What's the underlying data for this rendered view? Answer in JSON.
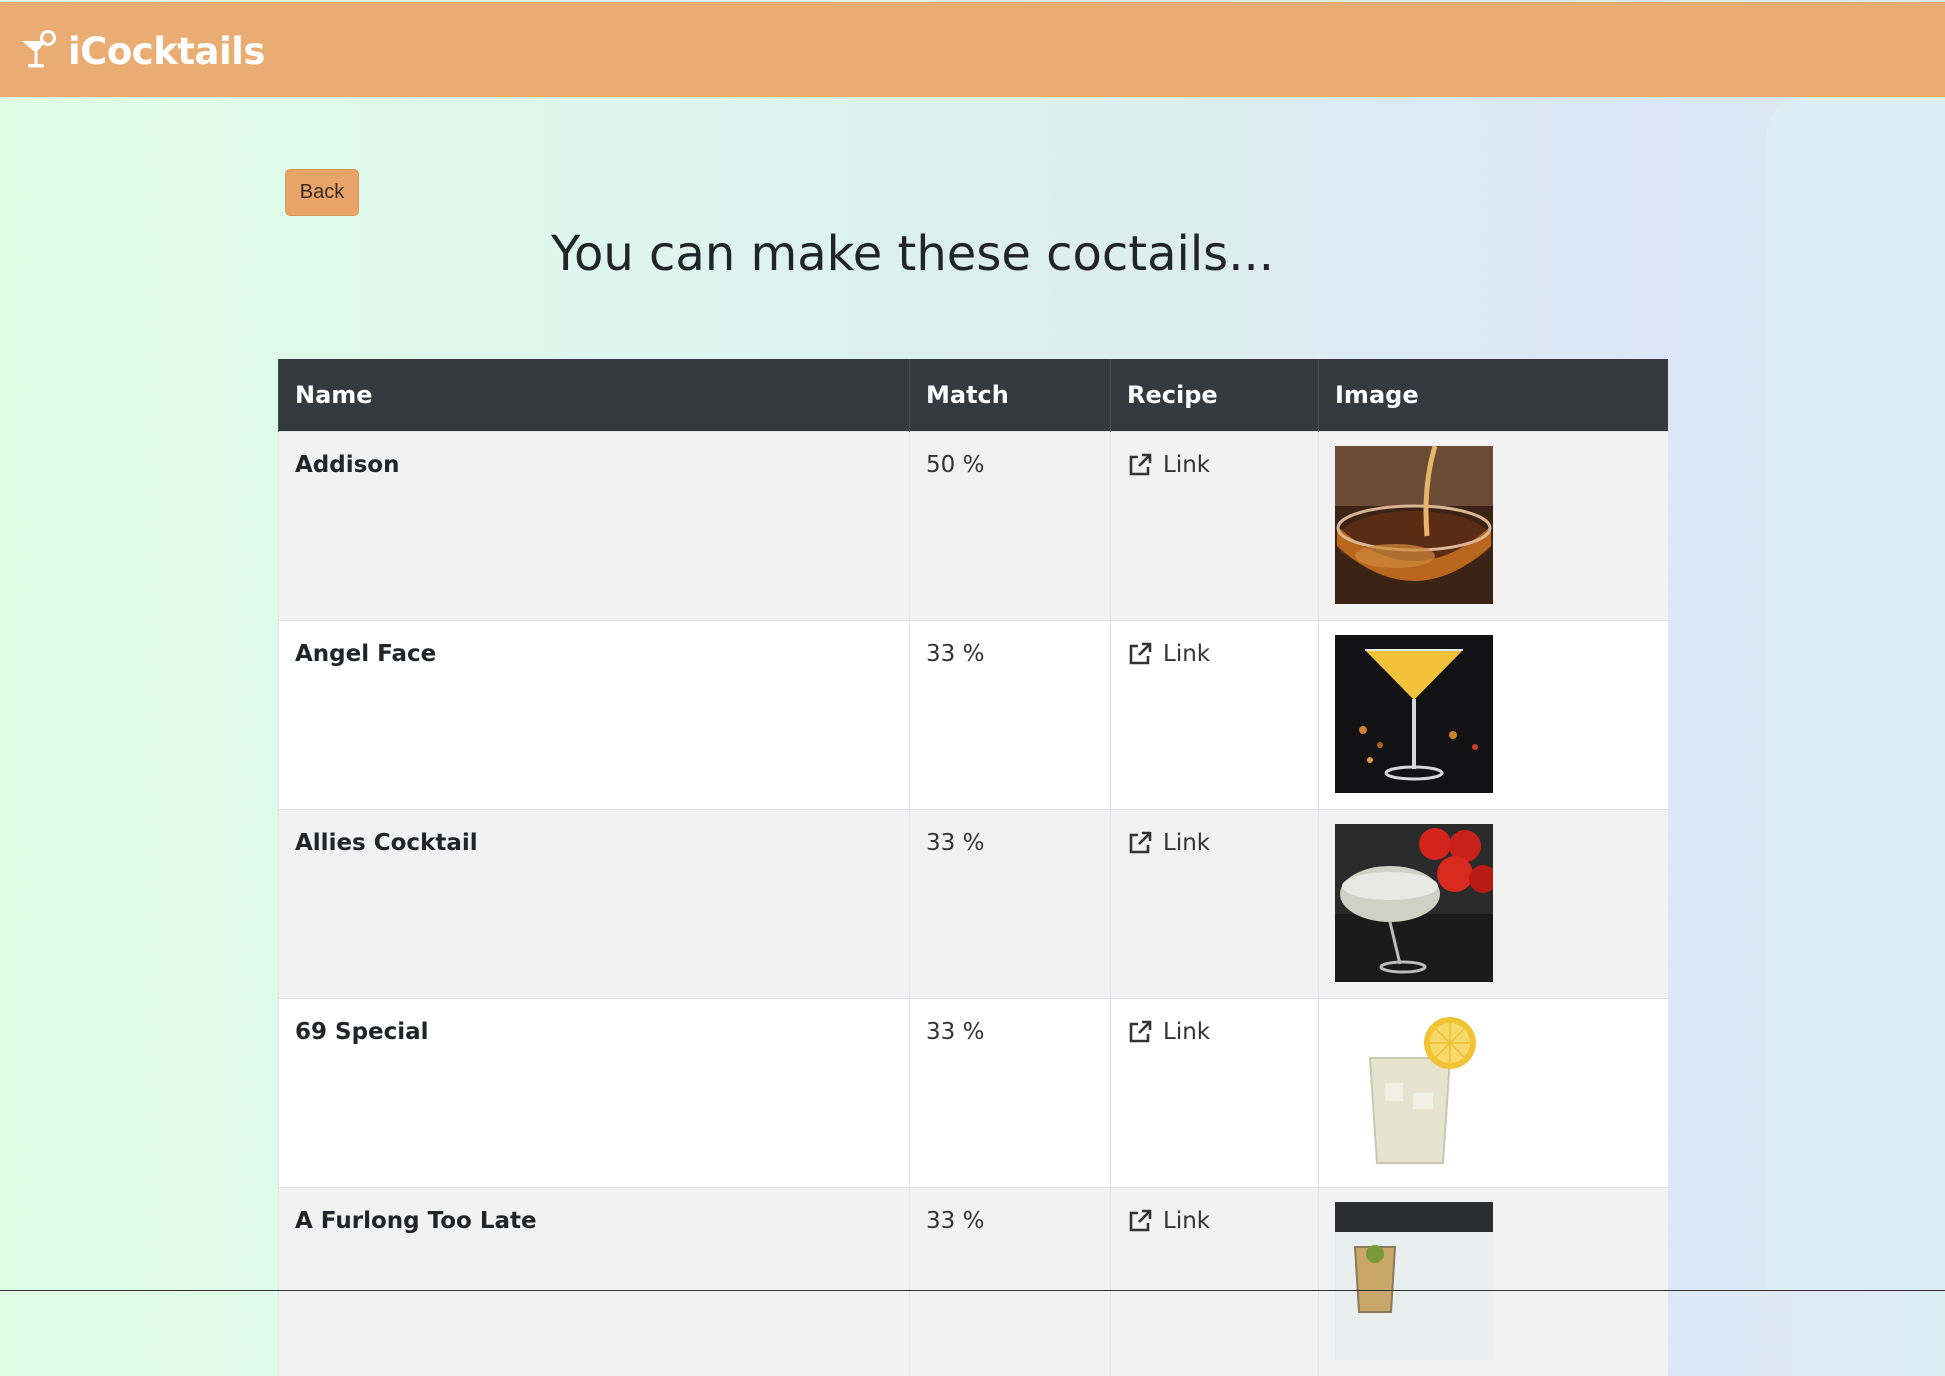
{
  "navbar": {
    "brand": "iCocktails",
    "brand_icon": "cocktail-glass-icon",
    "color": "#e9ac72"
  },
  "back_label": "Back",
  "page_title": "You can make these coctails...",
  "table": {
    "headers": [
      "Name",
      "Match",
      "Recipe",
      "Image"
    ],
    "rows": [
      {
        "name": "Addison",
        "match": "50 %",
        "recipe": "Link",
        "image": "amber-pour-image"
      },
      {
        "name": "Angel Face",
        "match": "33 %",
        "recipe": "Link",
        "image": "yellow-martini-image"
      },
      {
        "name": "Allies Cocktail",
        "match": "33 %",
        "recipe": "Link",
        "image": "coupe-tomatoes-image"
      },
      {
        "name": "69 Special",
        "match": "33 %",
        "recipe": "Link",
        "image": "lemon-tumbler-image"
      },
      {
        "name": "A Furlong Too Late",
        "match": "33 %",
        "recipe": "Link",
        "image": "rocks-glass-image"
      }
    ]
  }
}
